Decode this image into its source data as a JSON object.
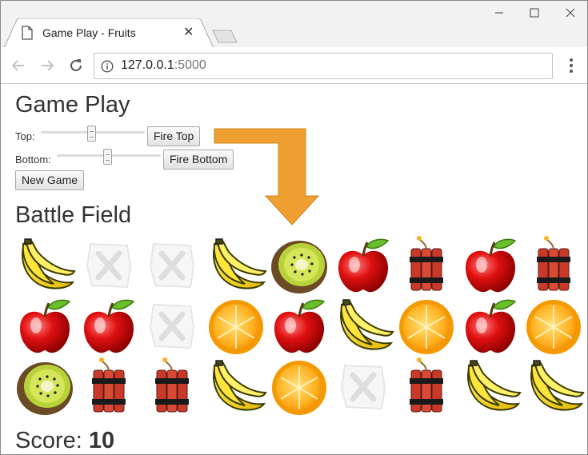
{
  "browser": {
    "tab_title": "Game Play - Fruits",
    "url_host": "127.0.0.1",
    "url_port": ":5000"
  },
  "page": {
    "heading": "Game Play",
    "top_label": "Top:",
    "bottom_label": "Bottom:",
    "top_slider_value": 0.49,
    "bottom_slider_value": 0.49,
    "fire_top_label": "Fire Top",
    "fire_bottom_label": "Fire Bottom",
    "new_game_label": "New Game",
    "battlefield_heading": "Battle Field",
    "score_label": "Score:",
    "score_value": "10"
  },
  "indicator_color": "#f0a030",
  "battlefield": [
    [
      "banana",
      "empty",
      "empty",
      "banana",
      "kiwi",
      "apple",
      "dynamite",
      "apple",
      "dynamite"
    ],
    [
      "apple",
      "apple",
      "empty",
      "orange",
      "apple",
      "banana",
      "orange",
      "apple",
      "orange"
    ],
    [
      "kiwi",
      "dynamite",
      "dynamite",
      "banana",
      "orange",
      "empty",
      "dynamite",
      "banana",
      "banana"
    ]
  ]
}
